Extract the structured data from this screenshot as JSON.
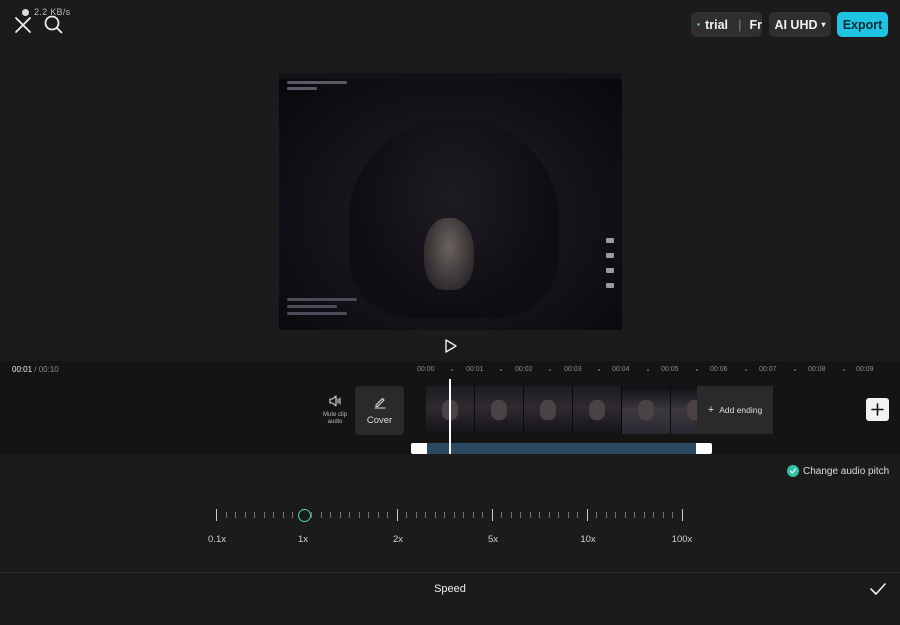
{
  "status": {
    "text": "2.2 KB/s"
  },
  "header": {
    "trial_label": "trial",
    "trial_extra": "Fr",
    "uhd_label": "AI UHD",
    "uhd_caret": "▾",
    "export_label": "Export"
  },
  "timeline": {
    "current_time": "00:01",
    "separator": "/",
    "total_time": "00:10",
    "ruler": [
      "00:00",
      "00:01",
      "00:02",
      "00:03",
      "00:04",
      "00:05",
      "00:06",
      "00:07",
      "00:08",
      "00:09"
    ],
    "mute_label": "Mute clip audio",
    "cover_label": "Cover",
    "add_ending_label": "Add ending"
  },
  "speed_panel": {
    "pitch_label": "Change audio pitch",
    "pitch_checked": true,
    "scale_labels": [
      "0.1x",
      "1x",
      "2x",
      "5x",
      "10x",
      "100x"
    ],
    "current_value": "1x",
    "title": "Speed"
  },
  "colors": {
    "accent": "#1fc4e2",
    "knob": "#3fd6b4",
    "check": "#2ec4a4"
  }
}
